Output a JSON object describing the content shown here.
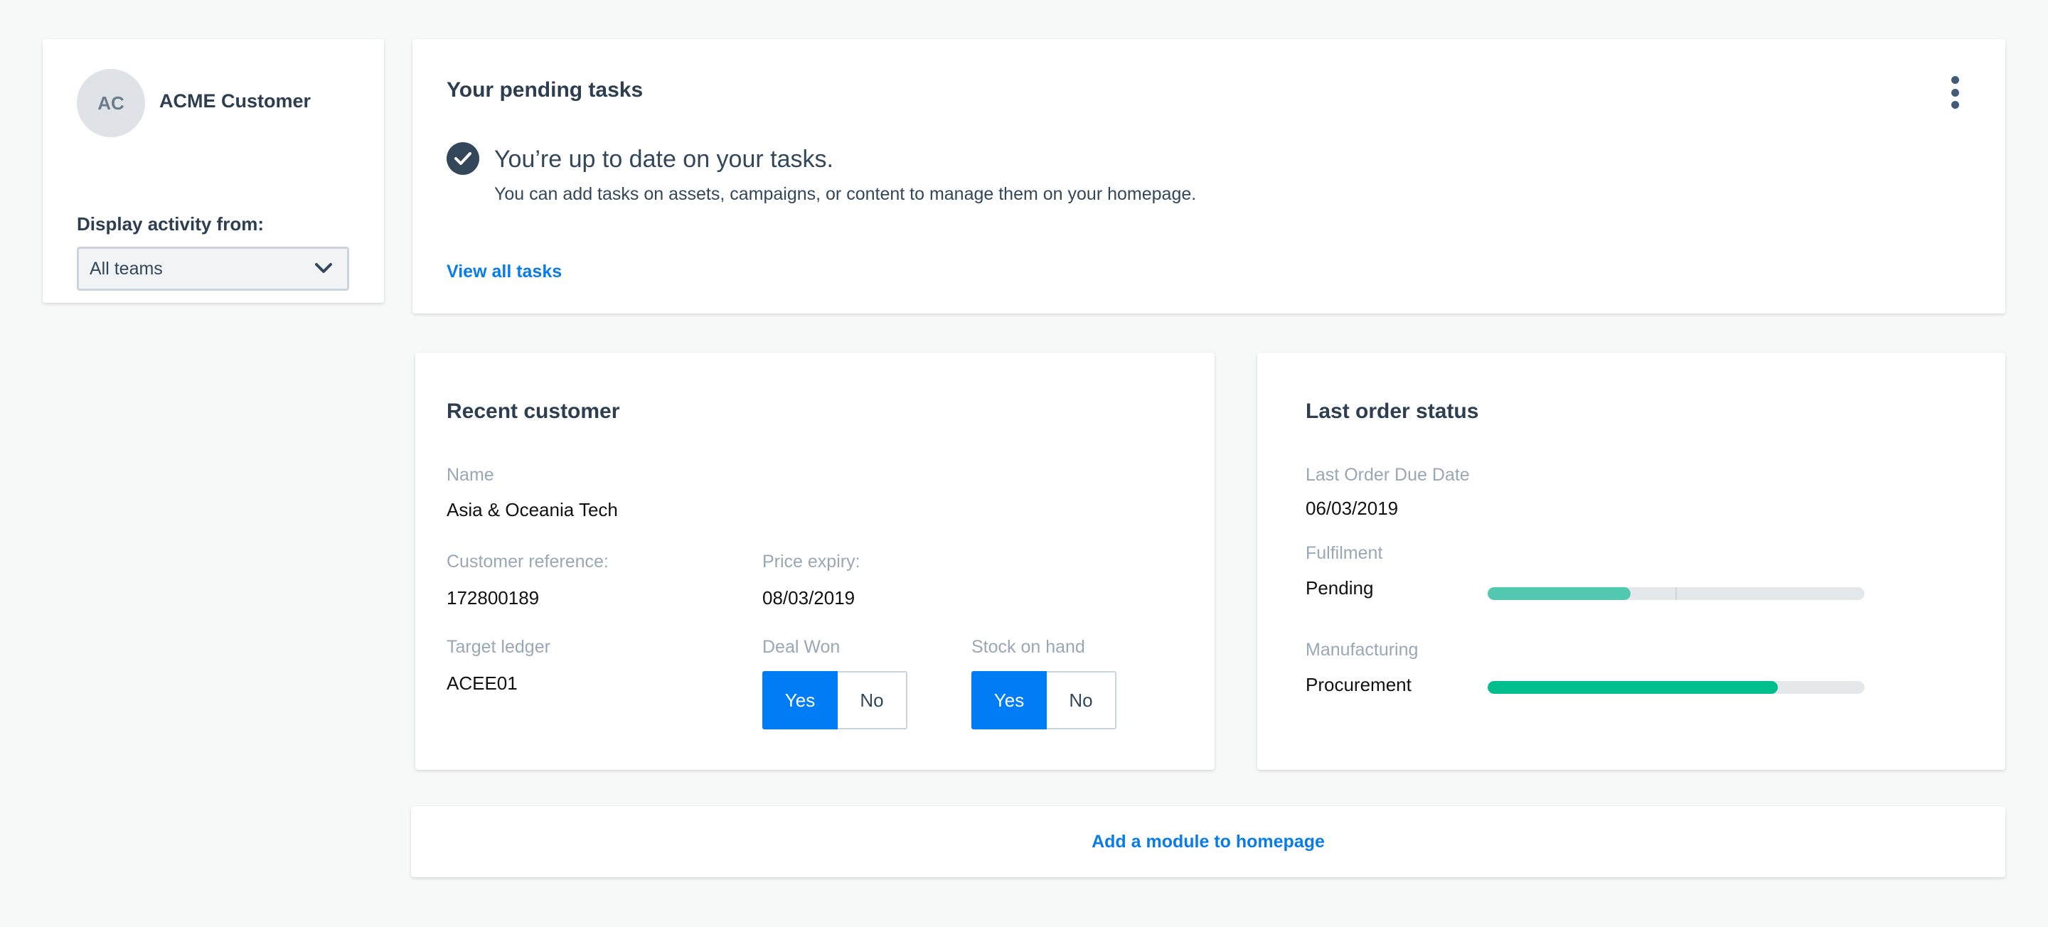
{
  "profile": {
    "avatar_initials": "AC",
    "name": "ACME Customer",
    "activity_label": "Display activity from:",
    "team_select_value": "All teams"
  },
  "tasks": {
    "title": "Your pending tasks",
    "status_heading": "You’re up to date on your tasks.",
    "status_detail": "You can add tasks on assets, campaigns, or content to manage them on your homepage.",
    "view_all_link": "View all tasks"
  },
  "recent_customer": {
    "title": "Recent customer",
    "name_label": "Name",
    "name_value": "Asia & Oceania Tech",
    "reference_label": "Customer reference:",
    "reference_value": "172800189",
    "price_expiry_label": "Price expiry:",
    "price_expiry_value": "08/03/2019",
    "ledger_label": "Target ledger",
    "ledger_value": "ACEE01",
    "deal_won_label": "Deal Won",
    "stock_label": "Stock on hand",
    "yes_label": "Yes",
    "no_label": "No",
    "deal_won_selected": "Yes",
    "stock_selected": "Yes"
  },
  "order_status": {
    "title": "Last order status",
    "due_date_label": "Last Order Due Date",
    "due_date_value": "06/03/2019",
    "fulfilment_label": "Fulfilment",
    "fulfilment_status": "Pending",
    "fulfilment_progress": 0.38,
    "manufacturing_label": "Manufacturing",
    "manufacturing_status": "Procurement",
    "manufacturing_progress": 0.77
  },
  "footer": {
    "add_module_link": "Add a module to homepage"
  },
  "colors": {
    "link": "#0a7ce8",
    "toggle_active": "#007cf5",
    "fulfilment_bar": "#52c8ae",
    "manufacturing_bar": "#00bf8f",
    "bar_track": "#e5e8eb"
  }
}
